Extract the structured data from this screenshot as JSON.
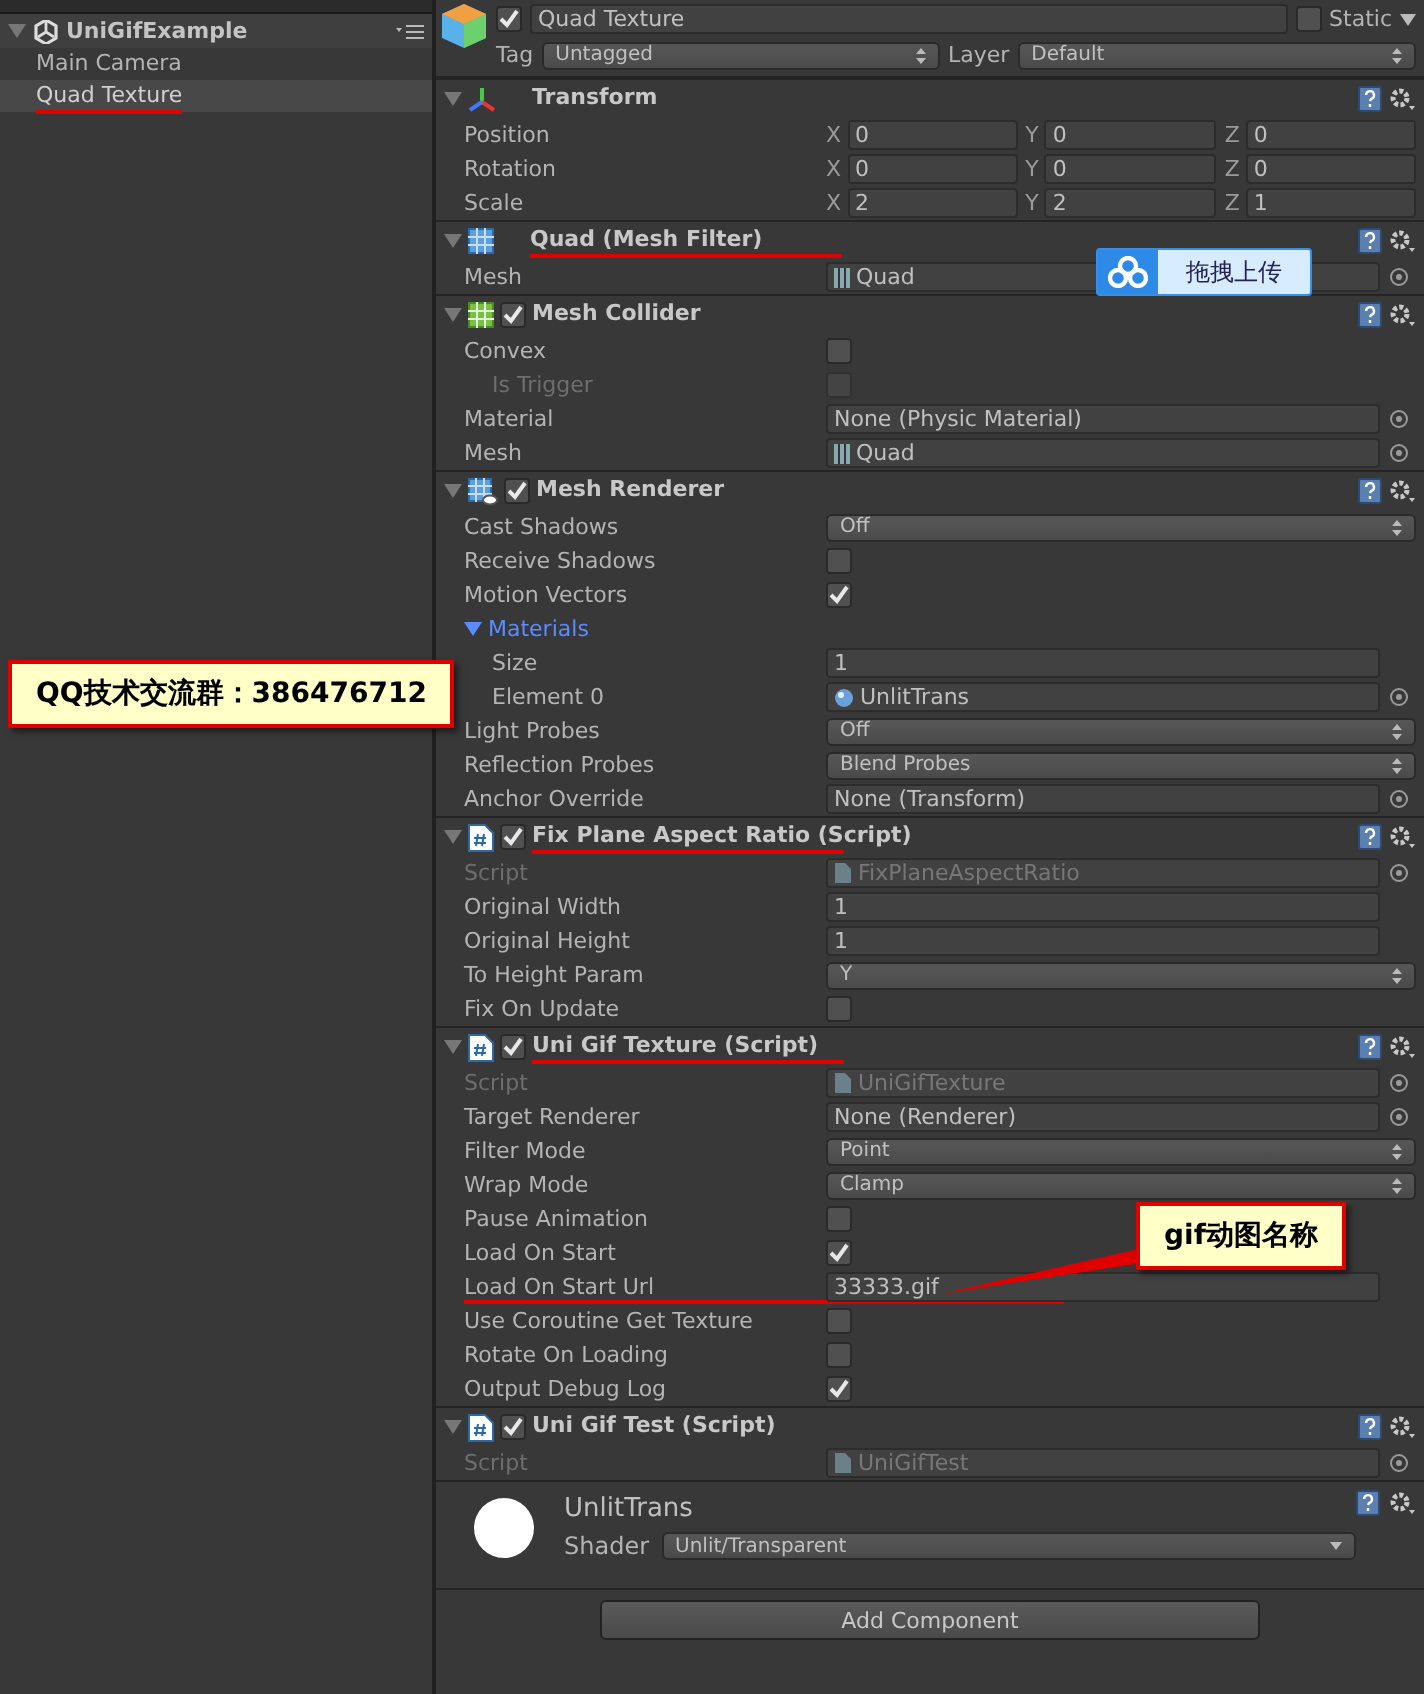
{
  "hierarchy": {
    "scene": "UniGifExample",
    "items": [
      {
        "label": "Main Camera",
        "selected": false,
        "underlined": false
      },
      {
        "label": "Quad Texture",
        "selected": true,
        "underlined": true
      }
    ]
  },
  "inspector": {
    "object": {
      "name": "Quad Texture",
      "active": true,
      "static_label": "Static",
      "static": false,
      "tag_label": "Tag",
      "tag": "Untagged",
      "layer_label": "Layer",
      "layer": "Default"
    },
    "components": [
      {
        "title": "Transform",
        "kind": "transform",
        "underlined": false,
        "properties": [
          {
            "kind": "vector3",
            "label": "Position",
            "fields": [
              {
                "axis": "X",
                "value": "0"
              },
              {
                "axis": "Y",
                "value": "0"
              },
              {
                "axis": "Z",
                "value": "0"
              }
            ]
          },
          {
            "kind": "vector3",
            "label": "Rotation",
            "fields": [
              {
                "axis": "X",
                "value": "0"
              },
              {
                "axis": "Y",
                "value": "0"
              },
              {
                "axis": "Z",
                "value": "0"
              }
            ]
          },
          {
            "kind": "vector3",
            "label": "Scale",
            "fields": [
              {
                "axis": "X",
                "value": "2"
              },
              {
                "axis": "Y",
                "value": "2"
              },
              {
                "axis": "Z",
                "value": "1"
              }
            ]
          }
        ]
      },
      {
        "title": "Quad (Mesh Filter)",
        "kind": "mesh_filter",
        "underlined": true,
        "properties": [
          {
            "kind": "mesh_ref",
            "label": "Mesh",
            "value": "Quad",
            "overlay_button": "拖拽上传"
          }
        ]
      },
      {
        "title": "Mesh Collider",
        "kind": "mesh_collider",
        "enabled": true,
        "underlined": false,
        "properties": [
          {
            "kind": "checkbox",
            "label": "Convex",
            "checked": false,
            "disabled": false,
            "children": [
              {
                "kind": "checkbox",
                "label": "Is Trigger",
                "checked": false,
                "disabled": true
              }
            ]
          },
          {
            "kind": "object",
            "label": "Material",
            "value": "None (Physic Material)"
          },
          {
            "kind": "mesh_ref",
            "label": "Mesh",
            "value": "Quad"
          }
        ]
      },
      {
        "title": "Mesh Renderer",
        "kind": "mesh_renderer",
        "enabled": true,
        "underlined": false,
        "properties": [
          {
            "kind": "dropdown",
            "label": "Cast Shadows",
            "value": "Off"
          },
          {
            "kind": "checkbox",
            "label": "Receive Shadows",
            "checked": false
          },
          {
            "kind": "checkbox",
            "label": "Motion Vectors",
            "checked": true
          },
          {
            "kind": "foldout",
            "label": "Materials",
            "expanded": true,
            "children": [
              {
                "kind": "text",
                "label": "Size",
                "value": "1"
              },
              {
                "kind": "material_ref",
                "label": "Element 0",
                "value": "UnlitTrans"
              }
            ]
          },
          {
            "kind": "dropdown",
            "label": "Light Probes",
            "value": "Off"
          },
          {
            "kind": "dropdown",
            "label": "Reflection Probes",
            "value": "Blend Probes"
          },
          {
            "kind": "object",
            "label": "Anchor Override",
            "value": "None (Transform)"
          }
        ]
      },
      {
        "title": "Fix Plane Aspect Ratio (Script)",
        "kind": "script",
        "enabled": true,
        "underlined": true,
        "properties": [
          {
            "kind": "script_ref",
            "label": "Script",
            "value": "FixPlaneAspectRatio",
            "disabled": true
          },
          {
            "kind": "text",
            "label": "Original Width",
            "value": "1"
          },
          {
            "kind": "text",
            "label": "Original Height",
            "value": "1"
          },
          {
            "kind": "dropdown",
            "label": "To Height Param",
            "value": "Y"
          },
          {
            "kind": "checkbox",
            "label": "Fix On Update",
            "checked": false
          }
        ]
      },
      {
        "title": "Uni Gif Texture (Script)",
        "kind": "script",
        "enabled": true,
        "underlined": true,
        "properties": [
          {
            "kind": "script_ref",
            "label": "Script",
            "value": "UniGifTexture",
            "disabled": true
          },
          {
            "kind": "object",
            "label": "Target Renderer",
            "value": "None (Renderer)"
          },
          {
            "kind": "dropdown",
            "label": "Filter Mode",
            "value": "Point"
          },
          {
            "kind": "dropdown",
            "label": "Wrap Mode",
            "value": "Clamp"
          },
          {
            "kind": "checkbox",
            "label": "Pause Animation",
            "checked": false
          },
          {
            "kind": "checkbox",
            "label": "Load On Start",
            "checked": true
          },
          {
            "kind": "text",
            "label": "Load On Start Url",
            "value": "33333.gif",
            "underlined": true,
            "note": "gif动图名称"
          },
          {
            "kind": "checkbox",
            "label": "Use Coroutine Get Texture",
            "checked": false
          },
          {
            "kind": "checkbox",
            "label": "Rotate On Loading",
            "checked": false
          },
          {
            "kind": "checkbox",
            "label": "Output Debug Log",
            "checked": true
          }
        ]
      },
      {
        "title": "Uni Gif Test (Script)",
        "kind": "script",
        "enabled": true,
        "underlined": false,
        "properties": [
          {
            "kind": "script_ref",
            "label": "Script",
            "value": "UniGifTest",
            "disabled": true
          }
        ]
      }
    ],
    "material": {
      "name": "UnlitTrans",
      "shader_label": "Shader",
      "shader": "Unlit/Transparent"
    },
    "add_component": "Add Component"
  },
  "qq_note": "QQ技术交流群：386476712"
}
